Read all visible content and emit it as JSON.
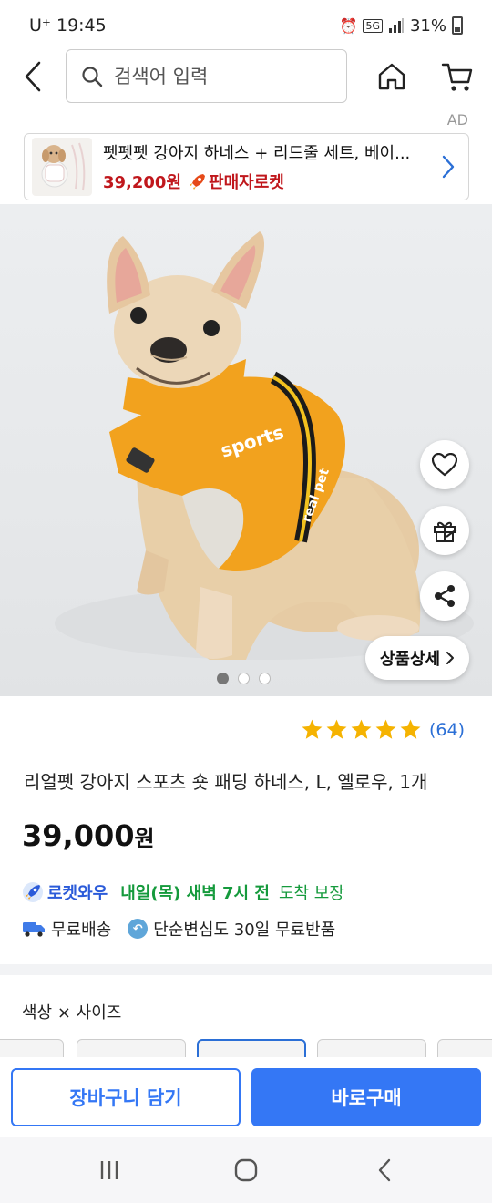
{
  "status_bar": {
    "carrier_time": "U⁺ 19:45",
    "battery": "31%"
  },
  "nav": {
    "search_placeholder": "검색어 입력"
  },
  "ad": {
    "label": "AD",
    "title": "펫펫펫 강아지 하네스 + 리드줄 세트, 베이...",
    "price": "39,200원",
    "badge": "판매자로켓"
  },
  "gallery": {
    "detail_button": "상품상세",
    "slide_count": 3,
    "active_slide": 1
  },
  "rating": {
    "stars": 5,
    "count": "(64)"
  },
  "product": {
    "title": "리얼펫 강아지 스포츠 숏 패딩 하네스, L, 옐로우, 1개",
    "price_number": "39,000",
    "price_unit": "원"
  },
  "delivery": {
    "rocket_wow": "로켓와우",
    "eta_bold": "내일(목) 새벽 7시 전",
    "eta_suffix": "도착 보장",
    "free_shipping": "무료배송",
    "return_policy": "단순변심도 30일 무료반품"
  },
  "options": {
    "label": "색상 × 사이즈"
  },
  "actions": {
    "add_to_cart": "장바구니 담기",
    "buy_now": "바로구매"
  },
  "colors": {
    "accent_blue": "#3477f5",
    "price_red": "#c0171c",
    "delivery_green": "#159a3c",
    "star_gold": "#f5b301",
    "harness_orange": "#f2a21e"
  }
}
